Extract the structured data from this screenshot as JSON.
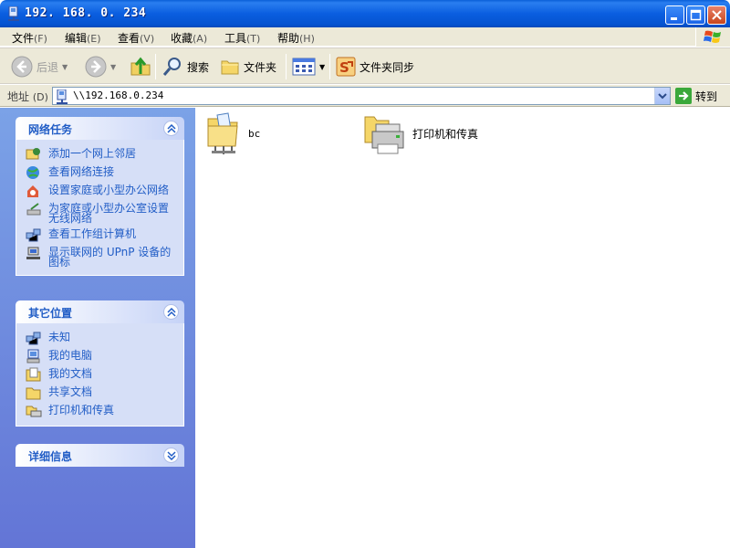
{
  "window": {
    "title": "192. 168. 0. 234"
  },
  "menu": [
    {
      "label": "文件",
      "acc": "(F)"
    },
    {
      "label": "编辑",
      "acc": "(E)"
    },
    {
      "label": "查看",
      "acc": "(V)"
    },
    {
      "label": "收藏",
      "acc": "(A)"
    },
    {
      "label": "工具",
      "acc": "(T)"
    },
    {
      "label": "帮助",
      "acc": "(H)"
    }
  ],
  "toolbar": {
    "back": "后退",
    "search": "搜索",
    "folders": "文件夹",
    "sync": "文件夹同步"
  },
  "address": {
    "label": "地址",
    "acc": "(D)",
    "value": "\\\\192.168.0.234",
    "go": "转到"
  },
  "panels": {
    "network_tasks": {
      "title": "网络任务",
      "items": [
        {
          "label": "添加一个网上邻居"
        },
        {
          "label": "查看网络连接"
        },
        {
          "label": "设置家庭或小型办公网络"
        },
        {
          "label": "为家庭或小型办公室设置无线网络"
        },
        {
          "label": "查看工作组计算机"
        },
        {
          "label": "显示联网的 UPnP 设备的图标"
        }
      ]
    },
    "other_places": {
      "title": "其它位置",
      "items": [
        {
          "label": "未知"
        },
        {
          "label": "我的电脑"
        },
        {
          "label": "我的文档"
        },
        {
          "label": "共享文档"
        },
        {
          "label": "打印机和传真"
        }
      ]
    },
    "details": {
      "title": "详细信息"
    }
  },
  "files": [
    {
      "name": "bc"
    },
    {
      "name": "打印机和传真"
    }
  ],
  "colors": {
    "title_blue": "#0a5fd8",
    "link_blue": "#215dc6",
    "panel_bg": "#d6dff7"
  }
}
